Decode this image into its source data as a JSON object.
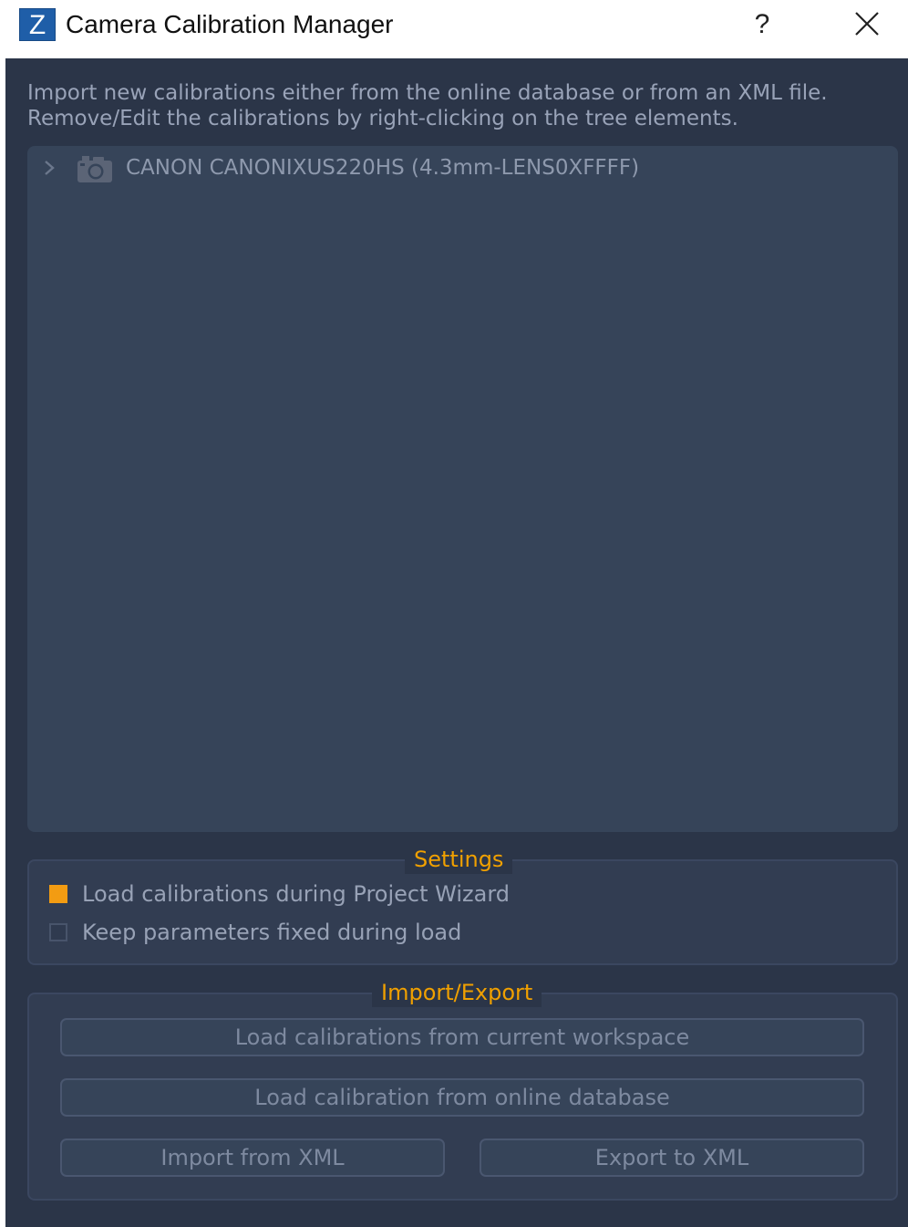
{
  "window": {
    "icon_letter": "Z",
    "title": "Camera Calibration Manager",
    "help_label": "?"
  },
  "intro": {
    "line1": "Import new calibrations either from the online database or from an XML file.",
    "line2": "Remove/Edit the calibrations by right-clicking on the tree elements."
  },
  "tree": {
    "items": [
      {
        "label": "CANON CANONIXUS220HS (4.3mm-LENS0XFFFF)",
        "icon": "camera-icon",
        "expanded": false
      }
    ]
  },
  "settings": {
    "title": "Settings",
    "options": [
      {
        "label": "Load calibrations during Project Wizard",
        "checked": true
      },
      {
        "label": "Keep parameters fixed during load",
        "checked": false
      }
    ]
  },
  "import_export": {
    "title": "Import/Export",
    "load_workspace_label": "Load calibrations from current workspace",
    "load_online_label": "Load calibration from online database",
    "import_xml_label": "Import from XML",
    "export_xml_label": "Export to XML"
  },
  "colors": {
    "accent": "#f39c12",
    "background": "#2b3548",
    "panel": "#364459",
    "app_icon": "#1f5ea8"
  }
}
